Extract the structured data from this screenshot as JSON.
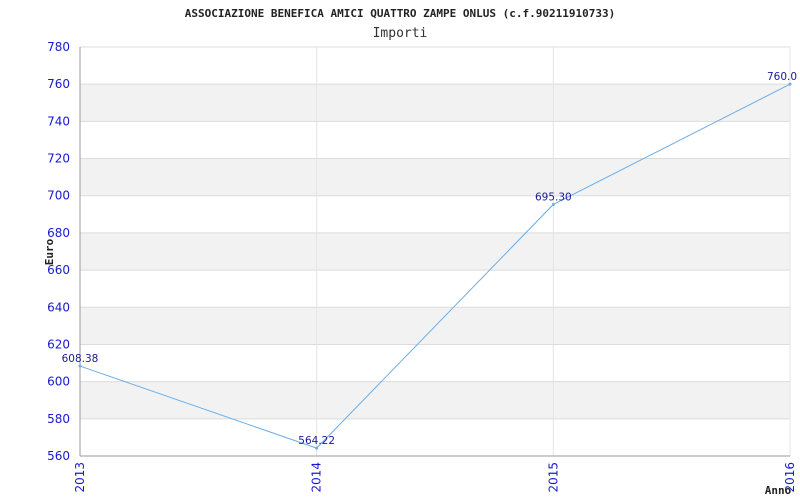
{
  "chart_data": {
    "type": "line",
    "title": "ASSOCIAZIONE BENEFICA AMICI QUATTRO ZAMPE ONLUS (c.f.90211910733)",
    "subtitle": "Importi",
    "xlabel": "Anno",
    "ylabel": "Euro",
    "categories": [
      "2013",
      "2014",
      "2015",
      "2016"
    ],
    "series": [
      {
        "values": [
          608.38,
          564.22,
          695.3,
          760.0
        ]
      }
    ],
    "data_labels": [
      "608.38",
      "564.22",
      "695.30",
      "760.0"
    ],
    "y_ticks": [
      560,
      580,
      600,
      620,
      640,
      660,
      680,
      700,
      720,
      740,
      760,
      780
    ],
    "ylim": [
      560,
      780
    ],
    "grid": true,
    "line_color": "#6aaee8",
    "tick_color": "#1a1acc",
    "band_color": "#f2f2f2"
  }
}
